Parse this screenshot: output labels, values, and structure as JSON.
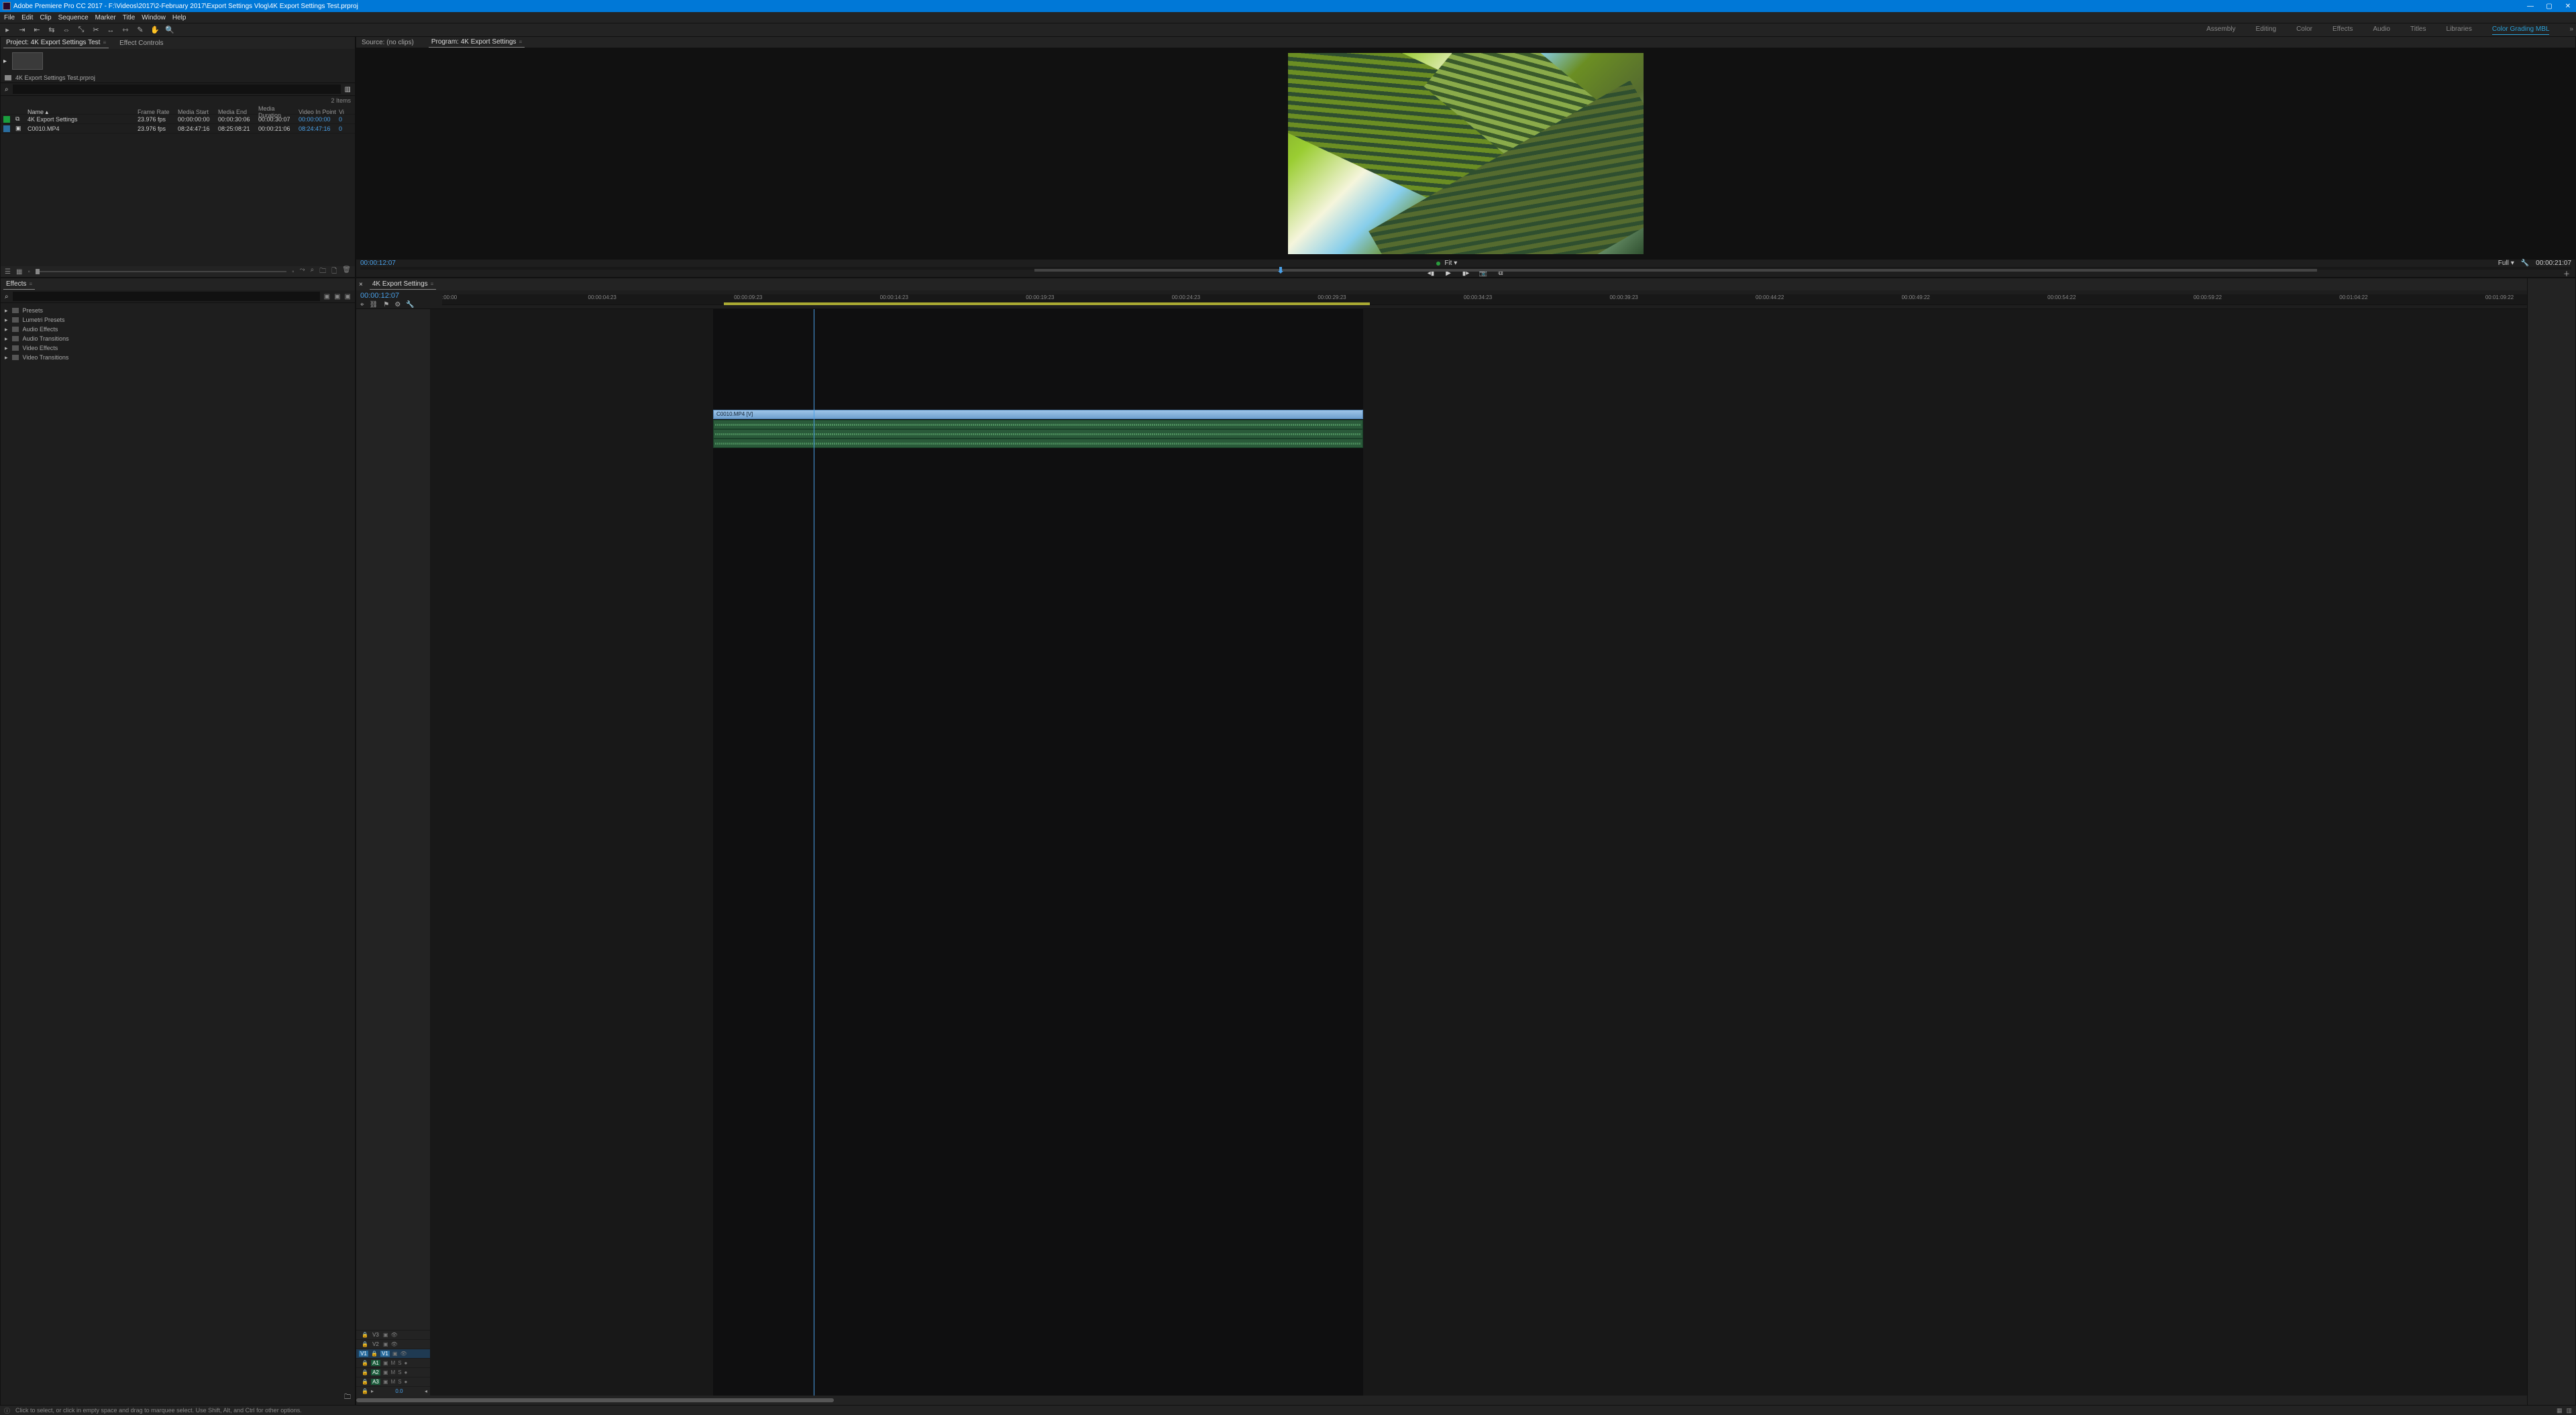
{
  "titlebar": {
    "app": "Adobe Premiere Pro CC 2017",
    "path": "F:\\Videos\\2017\\2-February 2017\\Export Settings Vlog\\4K Export Settings Test.prproj"
  },
  "menu": [
    "File",
    "Edit",
    "Clip",
    "Sequence",
    "Marker",
    "Title",
    "Window",
    "Help"
  ],
  "workspaces": {
    "items": [
      "Assembly",
      "Editing",
      "Color",
      "Effects",
      "Audio",
      "Titles",
      "Libraries",
      "Color Grading MBL"
    ],
    "active": "Color Grading MBL"
  },
  "project_panel": {
    "tab": "Project: 4K Export Settings Test",
    "other_tab": "Effect Controls",
    "file": "4K Export Settings Test.prproj",
    "items_count": "2 Items",
    "columns": [
      "Name",
      "Frame Rate",
      "Media Start",
      "Media End",
      "Media Duration",
      "Video In Point",
      "Vi"
    ],
    "rows": [
      {
        "icon": "seq",
        "name": "4K Export Settings",
        "fr": "23.976 fps",
        "ms": "00:00:00:00",
        "me": "00:00:30:06",
        "md": "00:00:30:07",
        "vip": "00:00:00:00",
        "vo": "0"
      },
      {
        "icon": "clip",
        "name": "C0010.MP4",
        "fr": "23.976 fps",
        "ms": "08:24:47:16",
        "me": "08:25:08:21",
        "md": "00:00:21:06",
        "vip": "08:24:47:16",
        "vo": "0"
      }
    ]
  },
  "source_panel": {
    "tab": "Source: (no clips)"
  },
  "program_panel": {
    "tab": "Program: 4K Export Settings",
    "timecode": "00:00:12:07",
    "fit": "Fit",
    "duration": "00:00:21:07",
    "zoom": "Full"
  },
  "effects_panel": {
    "tab": "Effects",
    "folders": [
      "Presets",
      "Lumetri Presets",
      "Audio Effects",
      "Audio Transitions",
      "Video Effects",
      "Video Transitions"
    ]
  },
  "timeline": {
    "tab": "4K Export Settings",
    "timecode": "00:00:12:07",
    "ruler": [
      ":00:00",
      "00:00:04:23",
      "00:00:09:23",
      "00:00:14:23",
      "00:00:19:23",
      "00:00:24:23",
      "00:00:29:23",
      "00:00:34:23",
      "00:00:39:23",
      "00:00:44:22",
      "00:00:49:22",
      "00:00:54:22",
      "00:00:59:22",
      "00:01:04:22",
      "00:01:09:22"
    ],
    "tracks": {
      "video": [
        "V3",
        "V2",
        "V1"
      ],
      "audio": [
        "A1",
        "A2",
        "A3"
      ],
      "source": {
        "v": "V1",
        "a": "A1"
      }
    },
    "clip_label": "C0010.MP4 [V]",
    "mix_label": "0.0"
  },
  "statusbar": {
    "hint": "Click to select, or click in empty space and drag to marquee select. Use Shift, Alt, and Ctrl for other options."
  }
}
